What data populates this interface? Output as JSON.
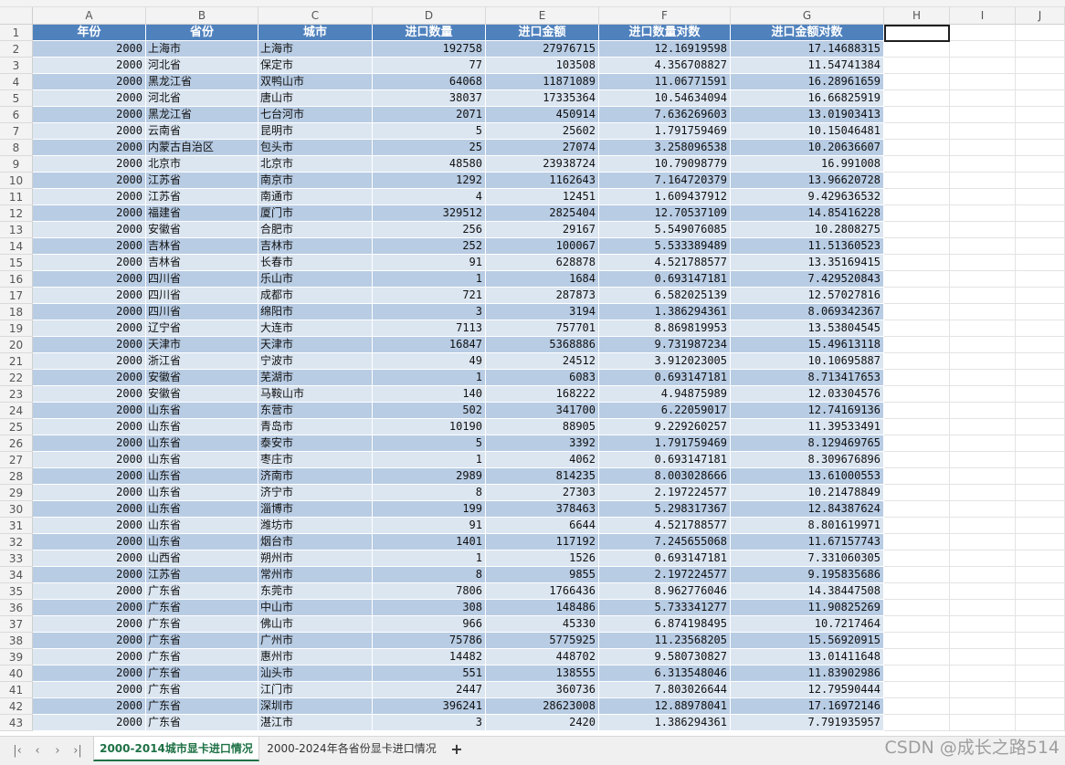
{
  "columns": [
    "A",
    "B",
    "C",
    "D",
    "E",
    "F",
    "G",
    "H",
    "I",
    "J"
  ],
  "header": [
    "年份",
    "省份",
    "城市",
    "进口数量",
    "进口金额",
    "进口数量对数",
    "进口金额对数"
  ],
  "rows": [
    [
      "2000",
      "上海市",
      "上海市",
      "192758",
      "27976715",
      "12.16919598",
      "17.14688315"
    ],
    [
      "2000",
      "河北省",
      "保定市",
      "77",
      "103508",
      "4.356708827",
      "11.54741384"
    ],
    [
      "2000",
      "黑龙江省",
      "双鸭山市",
      "64068",
      "11871089",
      "11.06771591",
      "16.28961659"
    ],
    [
      "2000",
      "河北省",
      "唐山市",
      "38037",
      "17335364",
      "10.54634094",
      "16.66825919"
    ],
    [
      "2000",
      "黑龙江省",
      "七台河市",
      "2071",
      "450914",
      "7.636269603",
      "13.01903413"
    ],
    [
      "2000",
      "云南省",
      "昆明市",
      "5",
      "25602",
      "1.791759469",
      "10.15046481"
    ],
    [
      "2000",
      "内蒙古自治区",
      "包头市",
      "25",
      "27074",
      "3.258096538",
      "10.20636607"
    ],
    [
      "2000",
      "北京市",
      "北京市",
      "48580",
      "23938724",
      "10.79098779",
      "16.991008"
    ],
    [
      "2000",
      "江苏省",
      "南京市",
      "1292",
      "1162643",
      "7.164720379",
      "13.96620728"
    ],
    [
      "2000",
      "江苏省",
      "南通市",
      "4",
      "12451",
      "1.609437912",
      "9.429636532"
    ],
    [
      "2000",
      "福建省",
      "厦门市",
      "329512",
      "2825404",
      "12.70537109",
      "14.85416228"
    ],
    [
      "2000",
      "安徽省",
      "合肥市",
      "256",
      "29167",
      "5.549076085",
      "10.2808275"
    ],
    [
      "2000",
      "吉林省",
      "吉林市",
      "252",
      "100067",
      "5.533389489",
      "11.51360523"
    ],
    [
      "2000",
      "吉林省",
      "长春市",
      "91",
      "628878",
      "4.521788577",
      "13.35169415"
    ],
    [
      "2000",
      "四川省",
      "乐山市",
      "1",
      "1684",
      "0.693147181",
      "7.429520843"
    ],
    [
      "2000",
      "四川省",
      "成都市",
      "721",
      "287873",
      "6.582025139",
      "12.57027816"
    ],
    [
      "2000",
      "四川省",
      "绵阳市",
      "3",
      "3194",
      "1.386294361",
      "8.069342367"
    ],
    [
      "2000",
      "辽宁省",
      "大连市",
      "7113",
      "757701",
      "8.869819953",
      "13.53804545"
    ],
    [
      "2000",
      "天津市",
      "天津市",
      "16847",
      "5368886",
      "9.731987234",
      "15.49613118"
    ],
    [
      "2000",
      "浙江省",
      "宁波市",
      "49",
      "24512",
      "3.912023005",
      "10.10695887"
    ],
    [
      "2000",
      "安徽省",
      "芜湖市",
      "1",
      "6083",
      "0.693147181",
      "8.713417653"
    ],
    [
      "2000",
      "安徽省",
      "马鞍山市",
      "140",
      "168222",
      "4.94875989",
      "12.03304576"
    ],
    [
      "2000",
      "山东省",
      "东营市",
      "502",
      "341700",
      "6.22059017",
      "12.74169136"
    ],
    [
      "2000",
      "山东省",
      "青岛市",
      "10190",
      "88905",
      "9.229260257",
      "11.39533491"
    ],
    [
      "2000",
      "山东省",
      "泰安市",
      "5",
      "3392",
      "1.791759469",
      "8.129469765"
    ],
    [
      "2000",
      "山东省",
      "枣庄市",
      "1",
      "4062",
      "0.693147181",
      "8.309676896"
    ],
    [
      "2000",
      "山东省",
      "济南市",
      "2989",
      "814235",
      "8.003028666",
      "13.61000553"
    ],
    [
      "2000",
      "山东省",
      "济宁市",
      "8",
      "27303",
      "2.197224577",
      "10.21478849"
    ],
    [
      "2000",
      "山东省",
      "淄博市",
      "199",
      "378463",
      "5.298317367",
      "12.84387624"
    ],
    [
      "2000",
      "山东省",
      "潍坊市",
      "91",
      "6644",
      "4.521788577",
      "8.801619971"
    ],
    [
      "2000",
      "山东省",
      "烟台市",
      "1401",
      "117192",
      "7.245655068",
      "11.67157743"
    ],
    [
      "2000",
      "山西省",
      "朔州市",
      "1",
      "1526",
      "0.693147181",
      "7.331060305"
    ],
    [
      "2000",
      "江苏省",
      "常州市",
      "8",
      "9855",
      "2.197224577",
      "9.195835686"
    ],
    [
      "2000",
      "广东省",
      "东莞市",
      "7806",
      "1766436",
      "8.962776046",
      "14.38447508"
    ],
    [
      "2000",
      "广东省",
      "中山市",
      "308",
      "148486",
      "5.733341277",
      "11.90825269"
    ],
    [
      "2000",
      "广东省",
      "佛山市",
      "966",
      "45330",
      "6.874198495",
      "10.7217464"
    ],
    [
      "2000",
      "广东省",
      "广州市",
      "75786",
      "5775925",
      "11.23568205",
      "15.56920915"
    ],
    [
      "2000",
      "广东省",
      "惠州市",
      "14482",
      "448702",
      "9.580730827",
      "13.01411648"
    ],
    [
      "2000",
      "广东省",
      "汕头市",
      "551",
      "138555",
      "6.313548046",
      "11.83902986"
    ],
    [
      "2000",
      "广东省",
      "江门市",
      "2447",
      "360736",
      "7.803026644",
      "12.79590444"
    ],
    [
      "2000",
      "广东省",
      "深圳市",
      "396241",
      "28623008",
      "12.88978041",
      "17.16972146"
    ],
    [
      "2000",
      "广东省",
      "湛江市",
      "3",
      "2420",
      "1.386294361",
      "7.791935957"
    ]
  ],
  "sheet_tabs": [
    {
      "label": "2000-2014城市显卡进口情况",
      "active": true
    },
    {
      "label": "2000-2024年各省份显卡进口情况",
      "active": false
    }
  ],
  "add_tab_label": "+",
  "nav_icons": [
    "first-sheet-icon",
    "prev-sheet-icon",
    "next-sheet-icon",
    "last-sheet-icon"
  ],
  "watermark": "CSDN @成长之路514",
  "colors": {
    "header_fill": "#4f81bd",
    "band_dark": "#b8cce4",
    "band_light": "#dce6f1",
    "active_tab": "#1e7145"
  }
}
